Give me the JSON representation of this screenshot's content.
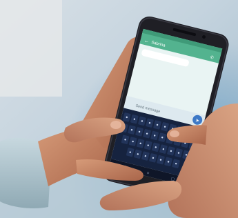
{
  "photo": {
    "subject": "hands-typing-on-smartphone",
    "screen": {
      "app_bar_title": "Sabrina",
      "message_placeholder": "Send message",
      "app_bar_color": "#53b38f",
      "conversation_background": "#e9f4f3",
      "keyboard_color": "#16233f",
      "send_button_color": "#3d79c6"
    },
    "palette": {
      "background_blur": "#a9c1cf",
      "skin": "#c68763",
      "sleeve": "#a9c3cd",
      "phone_body": "#1f1f25"
    }
  }
}
